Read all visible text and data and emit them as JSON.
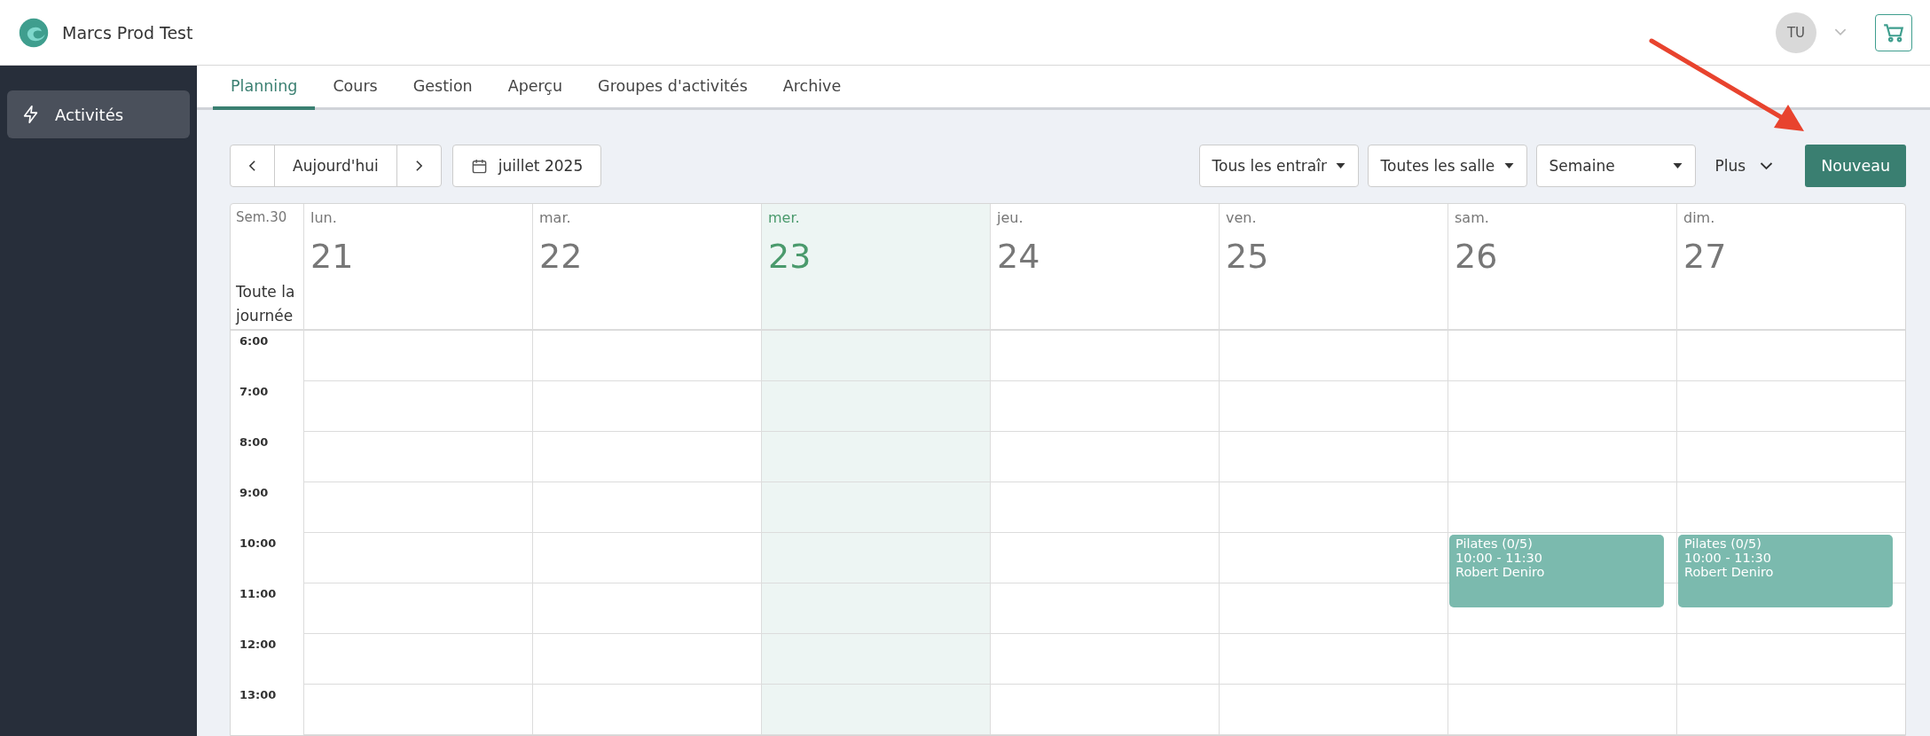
{
  "app": {
    "title": "Marcs Prod Test"
  },
  "user": {
    "initials": "TU"
  },
  "sidebar": {
    "items": [
      {
        "label": "Activités",
        "selected": true
      }
    ]
  },
  "tabs": [
    {
      "label": "Planning",
      "selected": true
    },
    {
      "label": "Cours",
      "selected": false
    },
    {
      "label": "Gestion",
      "selected": false
    },
    {
      "label": "Aperçu",
      "selected": false
    },
    {
      "label": "Groupes d'activités",
      "selected": false
    },
    {
      "label": "Archive",
      "selected": false
    }
  ],
  "toolbar": {
    "today": "Aujourd'hui",
    "month": "juillet 2025",
    "filters": [
      {
        "kind": "dropdown",
        "value": "Tous les entraîr"
      },
      {
        "kind": "dropdown",
        "value": "Toutes les salle"
      },
      {
        "kind": "dropdown",
        "value": "Semaine"
      }
    ],
    "more": "Plus",
    "new": "Nouveau"
  },
  "calendar": {
    "week": "Sem.30",
    "all_day": "Toute la journée",
    "days": [
      {
        "name": "lun.",
        "date": "21",
        "today": false
      },
      {
        "name": "mar.",
        "date": "22",
        "today": false
      },
      {
        "name": "mer.",
        "date": "23",
        "today": true
      },
      {
        "name": "jeu.",
        "date": "24",
        "today": false
      },
      {
        "name": "ven.",
        "date": "25",
        "today": false
      },
      {
        "name": "sam.",
        "date": "26",
        "today": false,
        "events": [
          {
            "title": "Pilates (0/5)",
            "time": "10:00 - 11:30",
            "trainer": "Robert Deniro"
          }
        ]
      },
      {
        "name": "dim.",
        "date": "27",
        "today": false,
        "events": [
          {
            "title": "Pilates (0/5)",
            "time": "10:00 - 11:30",
            "trainer": "Robert Deniro"
          }
        ]
      }
    ],
    "hours": [
      "6:00",
      "7:00",
      "8:00",
      "9:00",
      "10:00",
      "11:00",
      "12:00",
      "13:00"
    ]
  }
}
